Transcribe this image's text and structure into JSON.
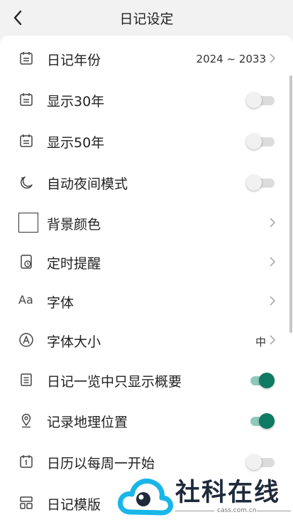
{
  "header": {
    "title": "日记设定"
  },
  "settings": [
    {
      "label": "日记年份",
      "value": "2024 ~ 2033",
      "icon": "calendar-icon"
    },
    {
      "label": "显示30年",
      "toggle": false,
      "icon": "calendar-icon"
    },
    {
      "label": "显示50年",
      "toggle": false,
      "icon": "calendar-icon"
    },
    {
      "label": "自动夜间模式",
      "toggle": false,
      "icon": "moon-icon"
    },
    {
      "label": "背景颜色",
      "icon": "color-swatch"
    },
    {
      "label": "定时提醒",
      "icon": "reminder-icon"
    },
    {
      "label": "字体",
      "icon_text": "Aa",
      "icon": "font-icon"
    },
    {
      "label": "字体大小",
      "value": "中",
      "icon": "font-size-icon"
    },
    {
      "label": "日记一览中只显示概要",
      "toggle": true,
      "icon": "list-icon"
    },
    {
      "label": "记录地理位置",
      "toggle": true,
      "icon": "location-icon"
    },
    {
      "label": "日历以每周一开始",
      "toggle": false,
      "icon": "calendar-one-icon"
    },
    {
      "label": "日记模版",
      "icon": "template-icon"
    }
  ],
  "colors": {
    "accent": "#0e7a62",
    "accent_track": "#8fc9b9"
  },
  "watermark": {
    "title": "社科在线",
    "domain": "cass.com.cn"
  }
}
